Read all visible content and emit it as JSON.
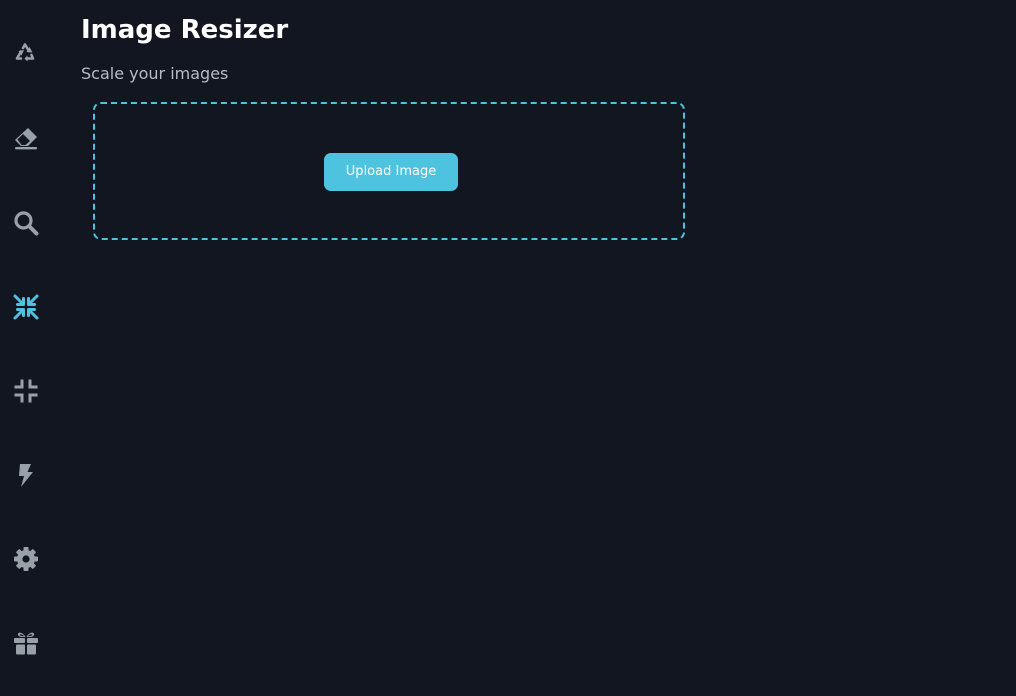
{
  "sidebar": {
    "items": [
      {
        "icon": "recycle-icon",
        "active": false
      },
      {
        "icon": "eraser-icon",
        "active": false
      },
      {
        "icon": "search-icon",
        "active": false
      },
      {
        "icon": "compress-icon",
        "active": true
      },
      {
        "icon": "compress-alt-icon",
        "active": false
      },
      {
        "icon": "bolt-icon",
        "active": false
      },
      {
        "icon": "gear-icon",
        "active": false
      },
      {
        "icon": "gift-icon",
        "active": false
      }
    ]
  },
  "page": {
    "title": "Image Resizer",
    "subtitle": "Scale your images"
  },
  "dropzone": {
    "button_label": "Upload Image"
  },
  "colors": {
    "background": "#111620",
    "accent": "#4ec3e0",
    "icon_inactive": "#9aa0a8",
    "text_primary": "#ffffff",
    "text_secondary": "#b8bcc4"
  }
}
